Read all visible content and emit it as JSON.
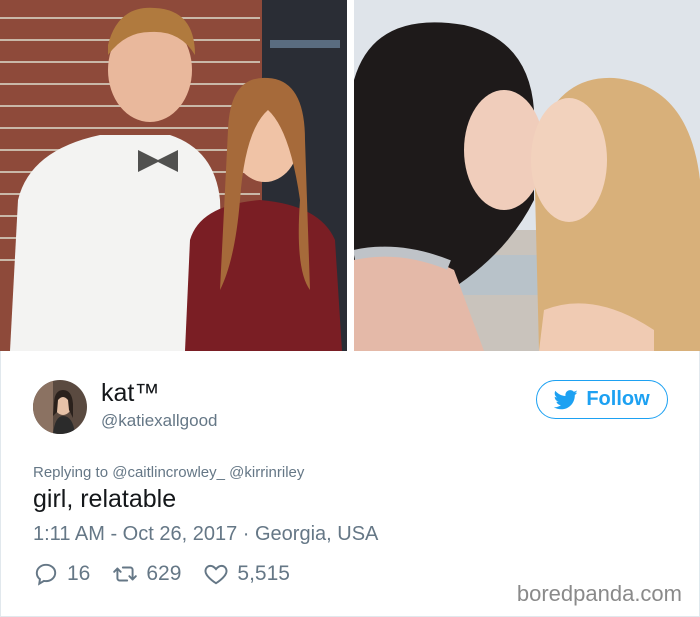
{
  "photos": {
    "left": {
      "icon": "photo-couple-prom"
    },
    "right": {
      "icon": "photo-two-women-kissing"
    }
  },
  "tweet": {
    "avatar": {
      "icon": "avatar-image"
    },
    "name": "kat™",
    "handle": "@katiexallgood",
    "follow_label": "Follow",
    "replying_prefix": "Replying to",
    "replying_to": [
      "@caitlincrowley_",
      "@kirrinriley"
    ],
    "text": "girl, relatable",
    "timestamp": "1:11 AM - Oct 26, 2017",
    "separator": "·",
    "location": "Georgia, USA",
    "replies": "16",
    "retweets": "629",
    "likes": "5,515"
  },
  "watermark": "boredpanda.com",
  "colors": {
    "accent": "#1da1f2",
    "secondary_text": "#657786",
    "primary_text": "#14171a"
  }
}
